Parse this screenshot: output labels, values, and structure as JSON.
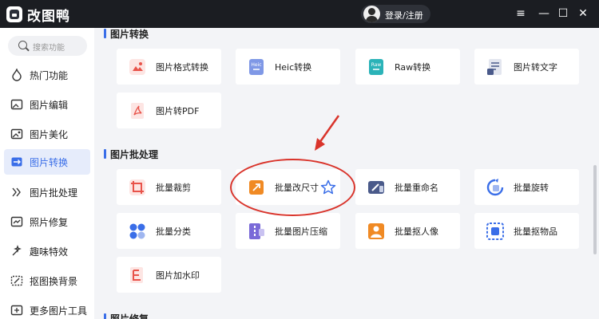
{
  "app": {
    "title": "改图鸭",
    "login_label": "登录/注册"
  },
  "window_controls": {
    "menu": "≡",
    "minimize": "—",
    "maximize": "☐",
    "close": "✕"
  },
  "search": {
    "placeholder": "搜索功能"
  },
  "sidebar": {
    "items": [
      {
        "label": "热门功能",
        "icon": "flame-icon",
        "active": false
      },
      {
        "label": "图片编辑",
        "icon": "image-edit-icon",
        "active": false
      },
      {
        "label": "图片美化",
        "icon": "image-beautify-icon",
        "active": false
      },
      {
        "label": "图片转换",
        "icon": "image-convert-icon",
        "active": true
      },
      {
        "label": "图片批处理",
        "icon": "batch-icon",
        "active": false
      },
      {
        "label": "照片修复",
        "icon": "photo-repair-icon",
        "active": false
      },
      {
        "label": "趣味特效",
        "icon": "effects-icon",
        "active": false
      },
      {
        "label": "抠图换背景",
        "icon": "cutout-icon",
        "active": false
      },
      {
        "label": "更多图片工具",
        "icon": "more-tools-icon",
        "active": false
      }
    ]
  },
  "sections": {
    "convert": {
      "title": "图片转换",
      "tools": [
        {
          "label": "图片格式转换",
          "icon": "format-convert-icon",
          "color": "#e8534a"
        },
        {
          "label": "Heic转换",
          "icon": "heic-icon",
          "color": "#3a6ee8"
        },
        {
          "label": "Raw转换",
          "icon": "raw-icon",
          "color": "#2bb3b8"
        },
        {
          "label": "图片转文字",
          "icon": "image-to-text-icon",
          "color": "#4a5a8a"
        },
        {
          "label": "图片转PDF",
          "icon": "image-to-pdf-icon",
          "color": "#e8534a"
        }
      ]
    },
    "batch": {
      "title": "图片批处理",
      "tools": [
        {
          "label": "批量裁剪",
          "icon": "batch-crop-icon",
          "color": "#e8534a"
        },
        {
          "label": "批量改尺寸",
          "icon": "batch-resize-icon",
          "color": "#f08a24"
        },
        {
          "label": "批量重命名",
          "icon": "batch-rename-icon",
          "color": "#4a5a8a"
        },
        {
          "label": "批量旋转",
          "icon": "batch-rotate-icon",
          "color": "#3a6ee8"
        },
        {
          "label": "批量分类",
          "icon": "batch-classify-icon",
          "color": "#3a6ee8"
        },
        {
          "label": "批量图片压缩",
          "icon": "batch-compress-icon",
          "color": "#7a6ad8"
        },
        {
          "label": "批量抠人像",
          "icon": "batch-portrait-cutout-icon",
          "color": "#f08a24"
        },
        {
          "label": "批量抠物品",
          "icon": "batch-object-cutout-icon",
          "color": "#3a6ee8"
        },
        {
          "label": "图片加水印",
          "icon": "watermark-icon",
          "color": "#e8534a"
        }
      ]
    },
    "repair": {
      "title": "照片修复"
    }
  },
  "favorite_icon": "star-icon"
}
